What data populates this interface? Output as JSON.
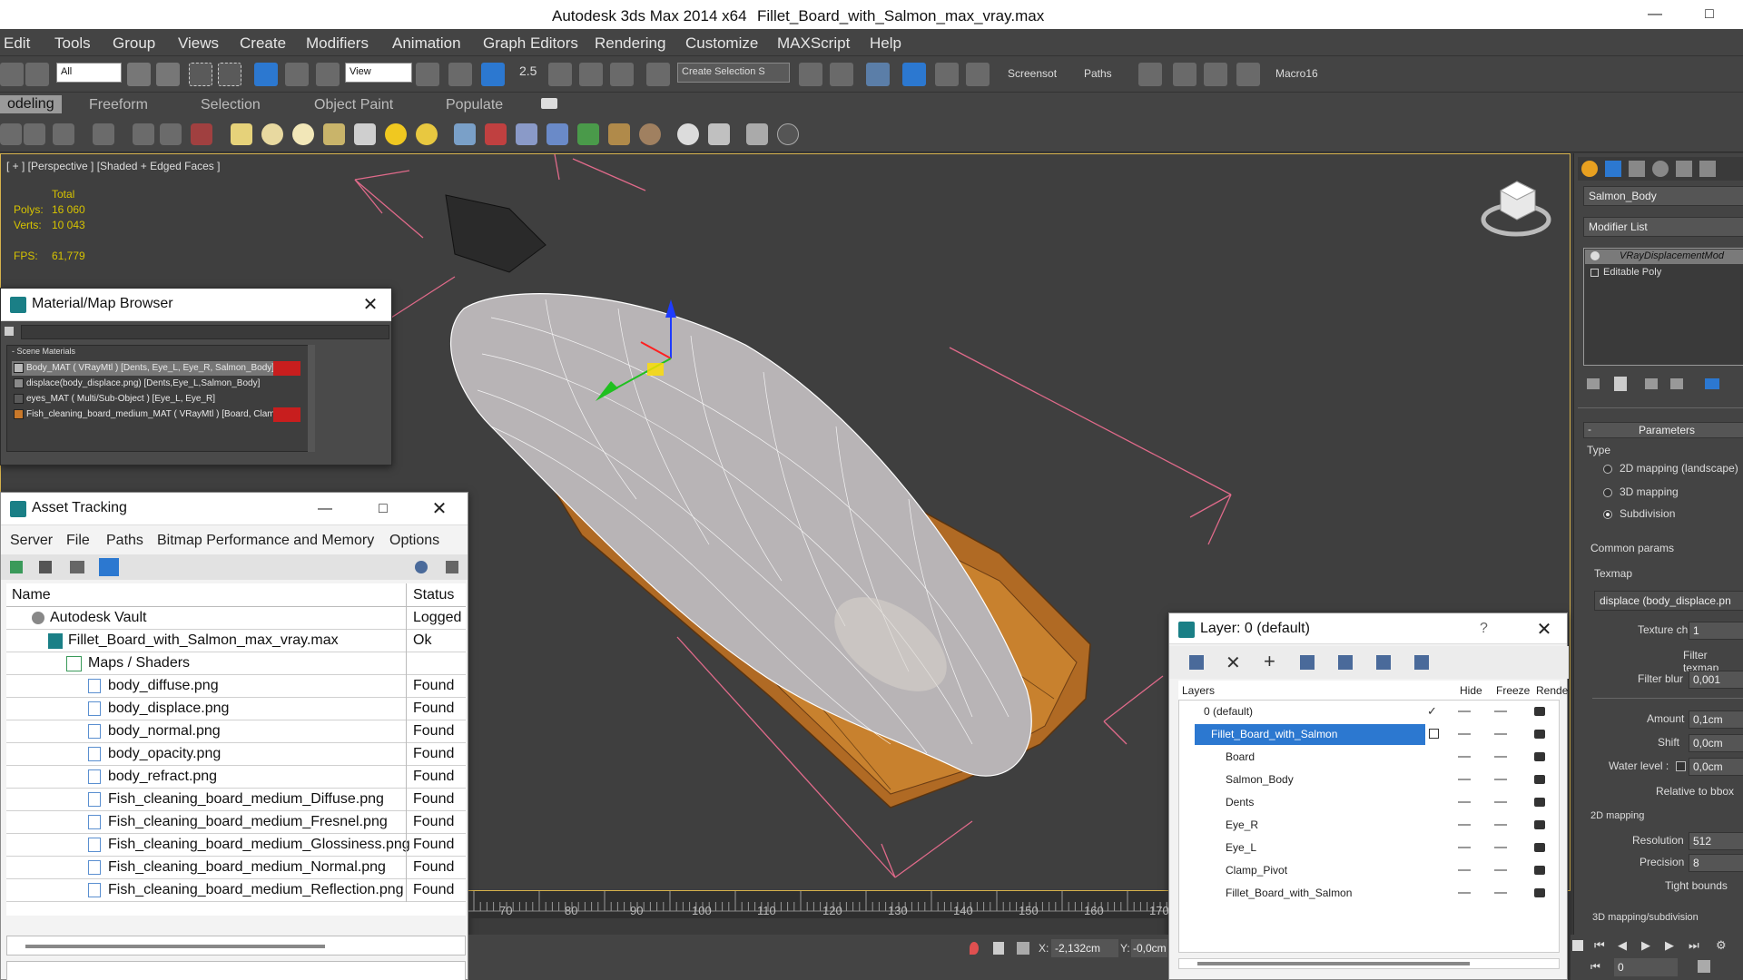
{
  "window": {
    "app_title": "Autodesk 3ds Max  2014 x64",
    "file_title": "Fillet_Board_with_Salmon_max_vray.max",
    "minimize": "—",
    "maximize": "□"
  },
  "menu": [
    "Edit",
    "Tools",
    "Group",
    "Views",
    "Create",
    "Modifiers",
    "Animation",
    "Graph Editors",
    "Rendering",
    "Customize",
    "MAXScript",
    "Help"
  ],
  "toolbar": {
    "filter_value": "All",
    "refcoord_value": "View",
    "selection_set_placeholder": "Create Selection S",
    "snap_label": "2.5",
    "screenshot_label": "Screensot",
    "paths_label": "Paths",
    "macro_label": "Macro16"
  },
  "ribbon_tabs": [
    "odeling",
    "Freeform",
    "Selection",
    "Object Paint",
    "Populate"
  ],
  "viewport": {
    "label": "[ + ] [Perspective ] [Shaded + Edged Faces ]",
    "stats": {
      "total_label": "Total",
      "polys_label": "Polys:",
      "polys_value": "16 060",
      "verts_label": "Verts:",
      "verts_value": "10 043",
      "fps_label": "FPS:",
      "fps_value": "61,779"
    }
  },
  "material_browser": {
    "title": "Material/Map Browser",
    "group_label": "- Scene Materials",
    "items": [
      {
        "label": "Body_MAT ( VRayMtl ) [Dents, Eye_L, Eye_R, Salmon_Body]",
        "color": "#c81e1e"
      },
      {
        "label": "displace(body_displace.png) [Dents,Eye_L,Salmon_Body]",
        "color": "#8a8a8a"
      },
      {
        "label": "eyes_MAT ( Multi/Sub-Object ) [Eye_L, Eye_R]",
        "color": "#5a5a5a"
      },
      {
        "label": "Fish_cleaning_board_medium_MAT ( VRayMtl ) [Board, Clamp_Piv",
        "color": "#c8782a"
      }
    ]
  },
  "asset_tracking": {
    "title": "Asset Tracking",
    "menu": [
      "Server",
      "File",
      "Paths",
      "Bitmap Performance and Memory",
      "Options"
    ],
    "col_name": "Name",
    "col_status": "Status",
    "rows": [
      {
        "name": "Autodesk Vault",
        "status": "Logged"
      },
      {
        "name": "Fillet_Board_with_Salmon_max_vray.max",
        "status": "Ok"
      },
      {
        "name": "Maps / Shaders",
        "status": ""
      },
      {
        "name": "body_diffuse.png",
        "status": "Found"
      },
      {
        "name": "body_displace.png",
        "status": "Found"
      },
      {
        "name": "body_normal.png",
        "status": "Found"
      },
      {
        "name": "body_opacity.png",
        "status": "Found"
      },
      {
        "name": "body_refract.png",
        "status": "Found"
      },
      {
        "name": "Fish_cleaning_board_medium_Diffuse.png",
        "status": "Found"
      },
      {
        "name": "Fish_cleaning_board_medium_Fresnel.png",
        "status": "Found"
      },
      {
        "name": "Fish_cleaning_board_medium_Glossiness.png",
        "status": "Found"
      },
      {
        "name": "Fish_cleaning_board_medium_Normal.png",
        "status": "Found"
      },
      {
        "name": "Fish_cleaning_board_medium_Reflection.png",
        "status": "Found"
      }
    ]
  },
  "layer_panel": {
    "title": "Layer: 0 (default)",
    "help": "?",
    "col_layers": "Layers",
    "col_hide": "Hide",
    "col_freeze": "Freeze",
    "col_render": "Rende",
    "rows": [
      {
        "name": "0 (default)"
      },
      {
        "name": "Fillet_Board_with_Salmon"
      },
      {
        "name": "Board"
      },
      {
        "name": "Salmon_Body"
      },
      {
        "name": "Dents"
      },
      {
        "name": "Eye_R"
      },
      {
        "name": "Eye_L"
      },
      {
        "name": "Clamp_Pivot"
      },
      {
        "name": "Fillet_Board_with_Salmon"
      }
    ]
  },
  "command_panel": {
    "object_name": "Salmon_Body",
    "modifier_list": "Modifier List",
    "stack": [
      "VRayDisplacementMod",
      "Editable Poly"
    ],
    "parameters_title": "Parameters",
    "type_label": "Type",
    "type_options": [
      "2D mapping (landscape)",
      "3D mapping",
      "Subdivision"
    ],
    "common_params": "Common params",
    "texmap_label": "Texmap",
    "texmap_value": "displace (body_displace.pn",
    "texture_chan_label": "Texture chan",
    "texture_chan_value": "1",
    "filter_texmap_label": "Filter texmap",
    "filter_blur_label": "Filter blur",
    "filter_blur_value": "0,001",
    "amount_label": "Amount",
    "amount_value": "0,1cm",
    "shift_label": "Shift",
    "shift_value": "0,0cm",
    "water_level_label": "Water level :",
    "water_level_value": "0,0cm",
    "relative_bbox_label": "Relative to bbox",
    "mapping_2d_label": "2D mapping",
    "resolution_label": "Resolution",
    "resolution_value": "512",
    "precision_label": "Precision",
    "precision_value": "8",
    "tight_bounds_label": "Tight bounds",
    "mapping_3d_label": "3D mapping/subdivision"
  },
  "timeline": {
    "ticks": [
      "70",
      "80",
      "90",
      "100",
      "110",
      "120",
      "130",
      "140",
      "150",
      "160",
      "170"
    ]
  },
  "status": {
    "x_label": "X:",
    "x_value": "-2,132cm",
    "y_label": "Y:",
    "y_value": "-0,0cm",
    "frame_value": "0"
  }
}
